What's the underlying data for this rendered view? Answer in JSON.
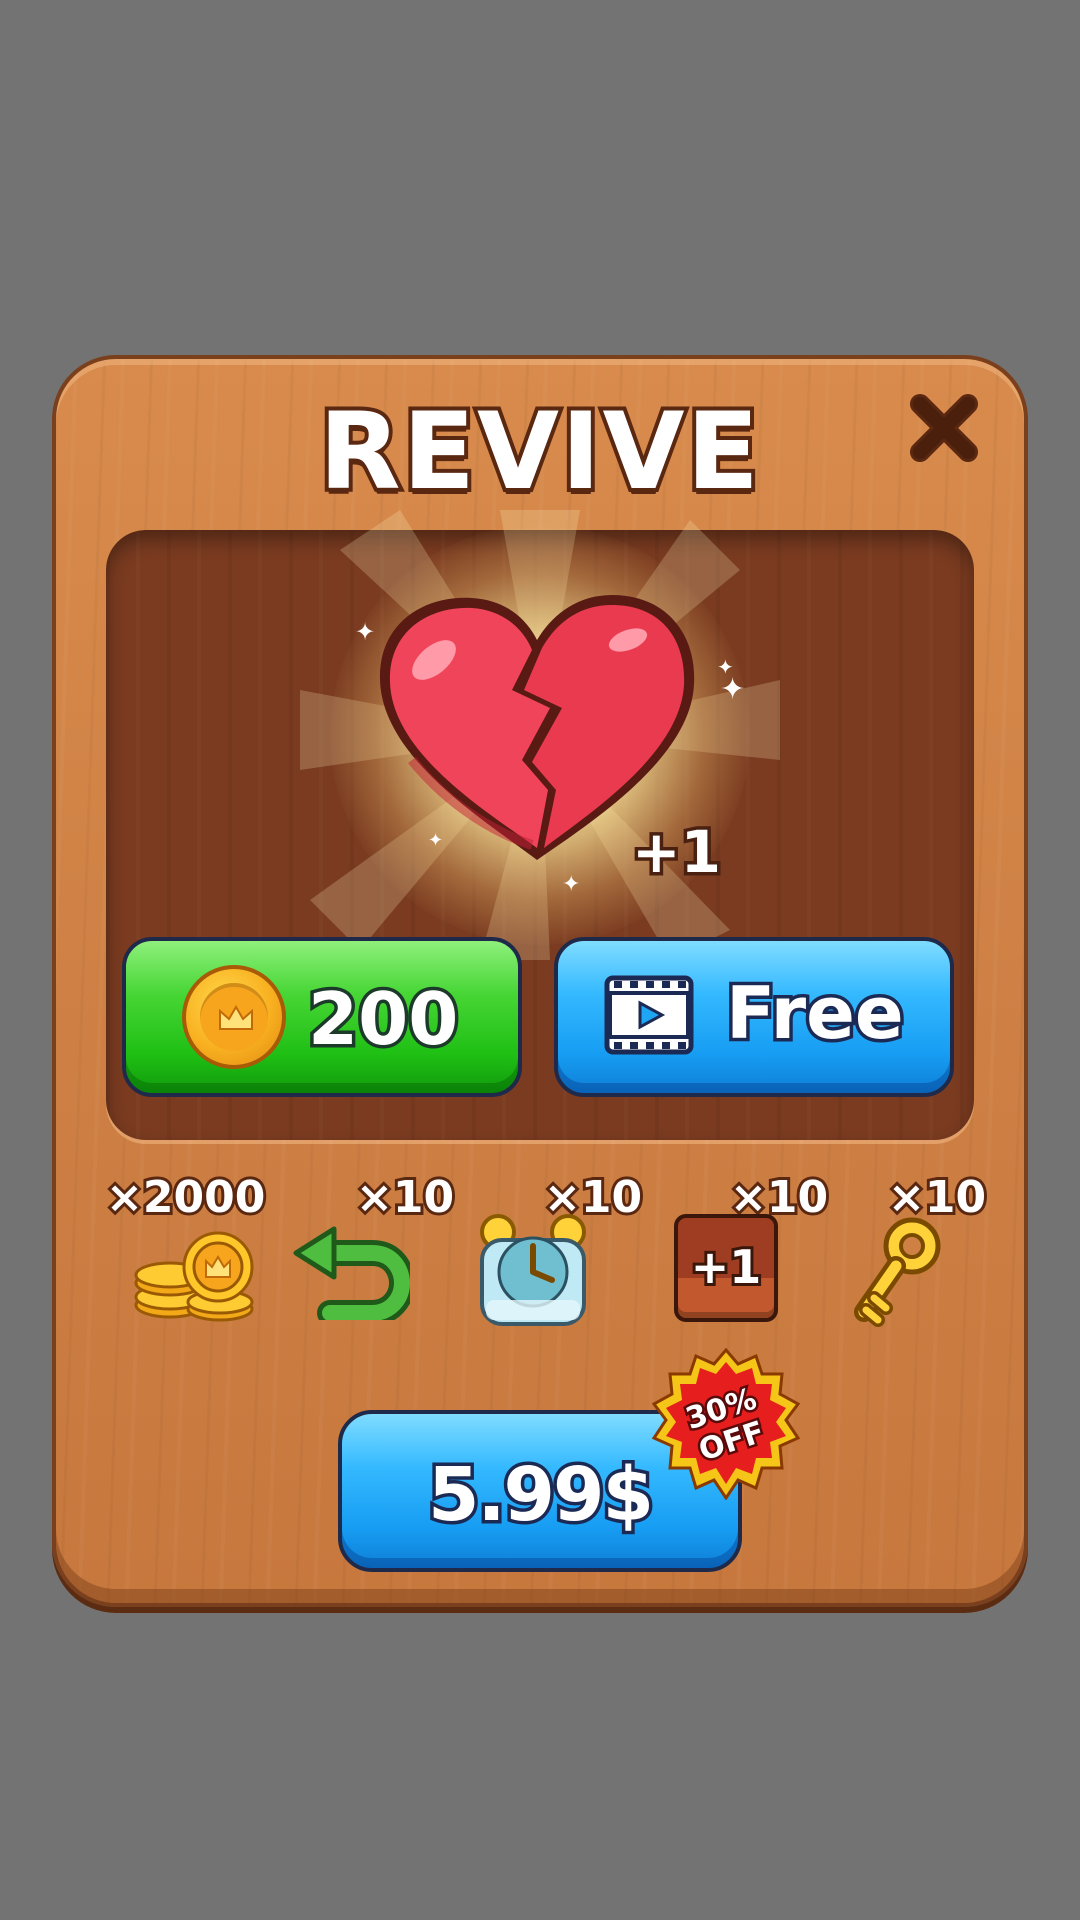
{
  "dialog": {
    "title": "REVIVE",
    "reward_label": "+1",
    "coin_button": {
      "price": "200",
      "icon": "crown-coin-icon"
    },
    "ad_button": {
      "label": "Free",
      "icon": "video-icon"
    },
    "bundle_items": [
      {
        "icon": "coin-stack-icon",
        "count": "×2000"
      },
      {
        "icon": "undo-arrow-icon",
        "count": "×10"
      },
      {
        "icon": "alarm-clock-icon",
        "count": "×10"
      },
      {
        "icon": "plus-one-block-icon",
        "count": "×10",
        "icon_text": "+1"
      },
      {
        "icon": "key-icon",
        "count": "×10"
      }
    ],
    "buy_button": {
      "price": "5.99$"
    },
    "discount_badge": {
      "line1": "30%",
      "line2": "OFF"
    }
  },
  "colors": {
    "panel_wood": "#d08345",
    "inner_wood": "#7a3b20",
    "green_button": "#2fc81f",
    "blue_button": "#1ea6f5",
    "badge_red": "#e61e1e",
    "badge_gold": "#f5c518"
  }
}
